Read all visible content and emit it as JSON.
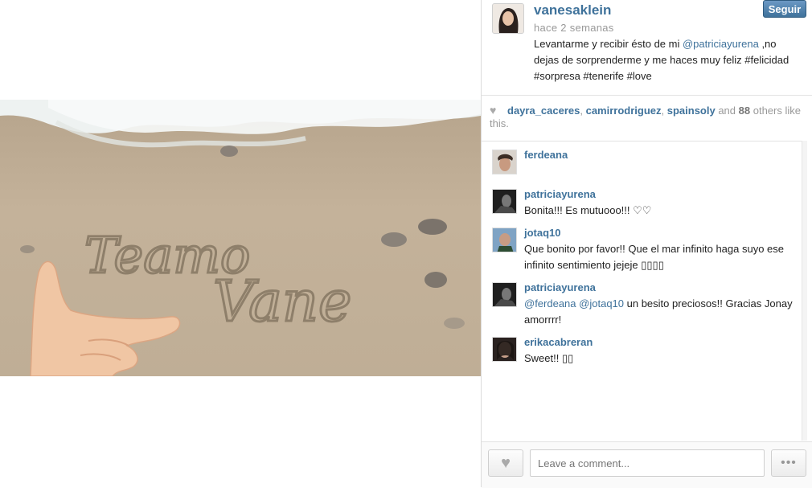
{
  "post": {
    "username": "vanesaklein",
    "time_ago": "hace 2 semanas",
    "follow_label": "Seguir",
    "caption_before": "Levantarme y recibir ésto de mi ",
    "caption_mention": "@patriciayurena",
    "caption_after": " ,no dejas de sorprenderme y me haces muy feliz #felicidad #sorpresa #tenerife #love",
    "photo_text_line1": "Teamo",
    "photo_text_line2": "Vane"
  },
  "likes": {
    "user1": "dayra_caceres",
    "sep1": ", ",
    "user2": "camirrodriguez",
    "sep2": ", ",
    "user3": "spainsoly",
    "and": " and ",
    "count": "88",
    "others": " others like this."
  },
  "comments": [
    {
      "user": "ferdeana",
      "text": ""
    },
    {
      "user": "patriciayurena",
      "text": "Bonita!!! Es mutuooo!!! ♡♡"
    },
    {
      "user": "jotaq10",
      "text": "Que bonito por favor!! Que el mar infinito haga suyo ese infinito sentimiento jejeje ▯▯▯▯"
    },
    {
      "user": "patriciayurena",
      "mention1": "@ferdeana",
      "mention2": "@jotaq10",
      "text": " un besito preciosos!! Gracias Jonay amorrrr!"
    },
    {
      "user": "erikacabreran",
      "text": "Sweet!! ▯▯"
    }
  ],
  "footer": {
    "placeholder": "Leave a comment...",
    "more_label": "•••"
  },
  "icons": {
    "heart": "heart-icon",
    "more": "more-dots-icon"
  },
  "colors": {
    "link": "#3f729b",
    "button": "#3f729b"
  }
}
